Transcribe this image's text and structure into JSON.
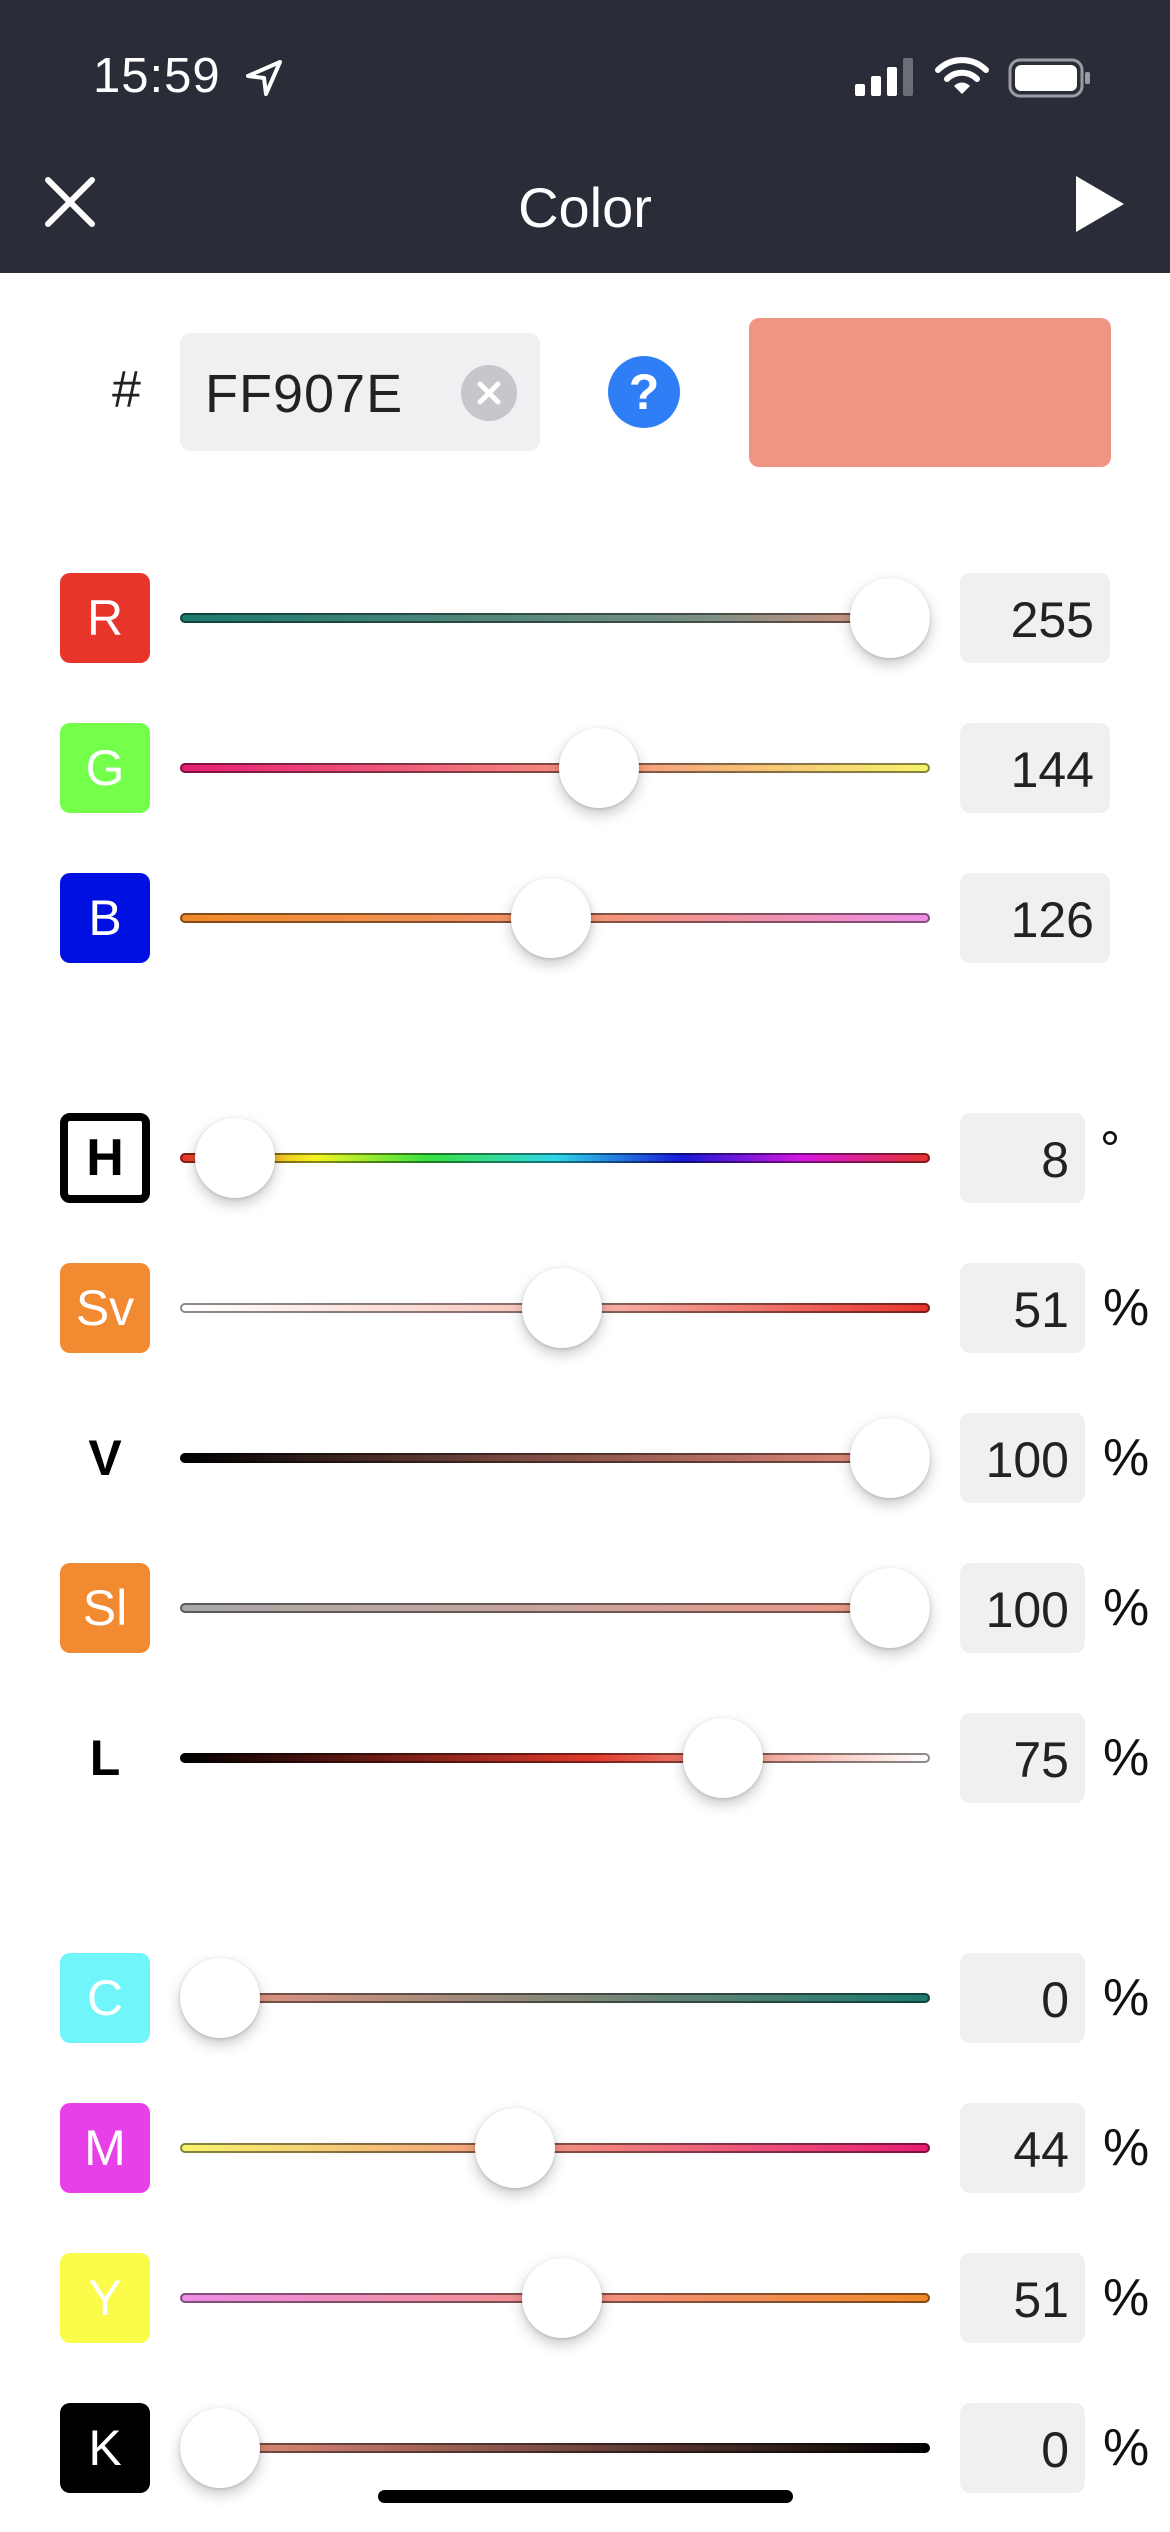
{
  "status_bar": {
    "time": "15:59"
  },
  "nav": {
    "title": "Color"
  },
  "hex": {
    "prefix": "#",
    "value": "FF907E",
    "help_label": "?",
    "swatch_color": "#f09583"
  },
  "rgb": [
    {
      "label": "R",
      "value": "255",
      "fraction": 1.0,
      "badge_color": "#e8352b",
      "gradient": "linear-gradient(to right,#1b7a6f,#7b8f84 70%,#f09583)"
    },
    {
      "label": "G",
      "value": "144",
      "fraction": 0.565,
      "badge_color": "#73ff4a",
      "gradient": "linear-gradient(to right,#e81d73,#f49380 55%,#f6f36d)"
    },
    {
      "label": "B",
      "value": "126",
      "fraction": 0.494,
      "badge_color": "#0010e0",
      "gradient": "linear-gradient(to right,#f08a28,#f29574 55%,#ee8ee6)"
    }
  ],
  "hsv": [
    {
      "label": "H",
      "value": "8",
      "unit": "°",
      "fraction": 0.022,
      "gradient": "linear-gradient(to right,#e8332c,#f5f520 18%,#38e040 33%,#30d8e8 50%,#1a18d8 67%,#d818e0 83%,#e8332c)"
    },
    {
      "label": "Sv",
      "value": "51",
      "unit": "%",
      "fraction": 0.51,
      "badge_color": "#f28a31",
      "gradient": "linear-gradient(to right,#ffffff,#f7c3b8 50%,#e8332c)"
    },
    {
      "label": "V",
      "value": "100",
      "unit": "%",
      "fraction": 1.0,
      "gradient": "linear-gradient(to right,#000000,#7a4a42 45%,#f09583)"
    },
    {
      "label": "Sl",
      "value": "100",
      "unit": "%",
      "fraction": 1.0,
      "badge_color": "#f28a31",
      "gradient": "linear-gradient(to right,#a8a8a8,#c8a49d 50%,#f09583)"
    },
    {
      "label": "L",
      "value": "75",
      "unit": "%",
      "fraction": 0.75,
      "gradient": "linear-gradient(to right,#000000,#e03a2c 55%,#f19b8d 75%,#ffffff)"
    }
  ],
  "cmyk": [
    {
      "label": "C",
      "value": "0",
      "unit": "%",
      "fraction": 0.0,
      "badge_color": "#6ff5fa",
      "gradient": "linear-gradient(to right,#f09583,#1b7a6f)"
    },
    {
      "label": "M",
      "value": "44",
      "unit": "%",
      "fraction": 0.44,
      "badge_color": "#e840e8",
      "gradient": "linear-gradient(to right,#f6f36d,#f19080 50%,#e81d73)"
    },
    {
      "label": "Y",
      "value": "51",
      "unit": "%",
      "fraction": 0.51,
      "badge_color": "#fbfb4a",
      "gradient": "linear-gradient(to right,#ee8ee6,#f19080 55%,#f08a28)"
    },
    {
      "label": "K",
      "value": "0",
      "unit": "%",
      "fraction": 0.0,
      "badge_color": "#000000",
      "gradient": "linear-gradient(to right,#f09583,#000000)"
    }
  ]
}
